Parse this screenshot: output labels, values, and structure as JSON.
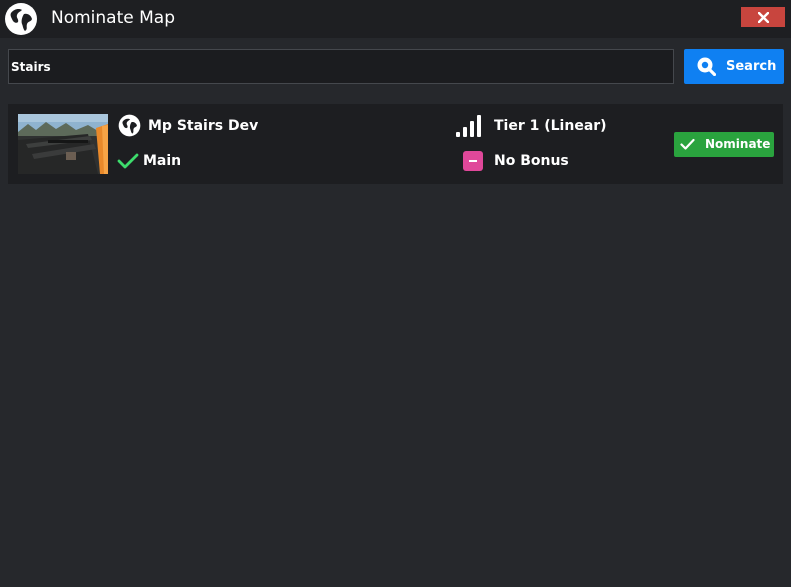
{
  "window": {
    "title": "Nominate Map",
    "logo_icon": "globe-logo-icon",
    "close_icon": "close-icon"
  },
  "search": {
    "value": "Stairs",
    "button_label": "Search",
    "button_icon": "search-icon"
  },
  "results": [
    {
      "map_name": "Mp Stairs Dev",
      "map_icon": "globe-logo-icon",
      "track": "Main",
      "track_icon": "check-icon",
      "tier": "Tier 1 (Linear)",
      "tier_icon": "signal-bars-icon",
      "bonus": "No Bonus",
      "bonus_icon": "minus-square-icon",
      "action_label": "Nominate",
      "action_icon": "check-icon"
    }
  ],
  "colors": {
    "background": "#26282c",
    "titlebar": "#1e1f22",
    "close": "#c8453e",
    "search_button": "#0f80f2",
    "nominate_button": "#2aa33e",
    "check": "#3ddc6c",
    "bonus": "#e0489a"
  }
}
